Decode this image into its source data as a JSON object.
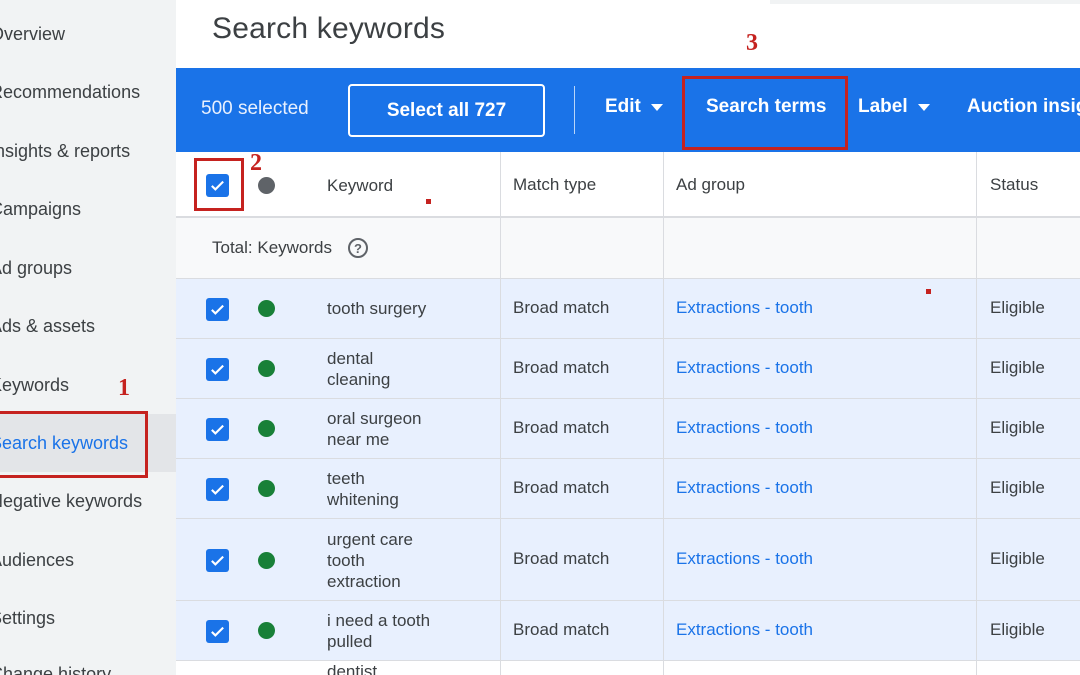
{
  "sidebar": {
    "items": [
      {
        "label": "Overview"
      },
      {
        "label": "Recommendations"
      },
      {
        "label": "Insights & reports"
      },
      {
        "label": "Campaigns"
      },
      {
        "label": "Ad groups"
      },
      {
        "label": "Ads & assets"
      },
      {
        "label": "Keywords"
      },
      {
        "label": "Search keywords"
      },
      {
        "label": "Negative keywords"
      },
      {
        "label": "Audiences"
      },
      {
        "label": "Settings"
      },
      {
        "label": "Change history"
      }
    ]
  },
  "page": {
    "title": "Search keywords"
  },
  "action_bar": {
    "selected_text": "500 selected",
    "select_all_label": "Select all 727",
    "edit_label": "Edit",
    "search_terms_label": "Search terms",
    "label_label": "Label",
    "auction_label": "Auction insights"
  },
  "table": {
    "headers": {
      "keyword": "Keyword",
      "match_type": "Match type",
      "ad_group": "Ad group",
      "status": "Status"
    },
    "total_label": "Total: Keywords",
    "rows": [
      {
        "keyword": "tooth surgery",
        "match_type": "Broad match",
        "ad_group": "Extractions - tooth",
        "status": "Eligible"
      },
      {
        "keyword": "dental cleaning",
        "match_type": "Broad match",
        "ad_group": "Extractions - tooth",
        "status": "Eligible"
      },
      {
        "keyword": "oral surgeon near me",
        "match_type": "Broad match",
        "ad_group": "Extractions - tooth",
        "status": "Eligible"
      },
      {
        "keyword": "teeth whitening",
        "match_type": "Broad match",
        "ad_group": "Extractions - tooth",
        "status": "Eligible"
      },
      {
        "keyword": "urgent care tooth extraction",
        "match_type": "Broad match",
        "ad_group": "Extractions - tooth",
        "status": "Eligible"
      },
      {
        "keyword": "i need a tooth pulled",
        "match_type": "Broad match",
        "ad_group": "Extractions - tooth",
        "status": "Eligible"
      },
      {
        "keyword": "dentist",
        "match_type": "",
        "ad_group": "",
        "status": ""
      }
    ]
  },
  "annotations": {
    "step1": "1",
    "step2": "2",
    "step3": "3"
  },
  "colors": {
    "accent": "#1a73e8",
    "annotation": "#c5221f",
    "status_ok": "#188038"
  }
}
